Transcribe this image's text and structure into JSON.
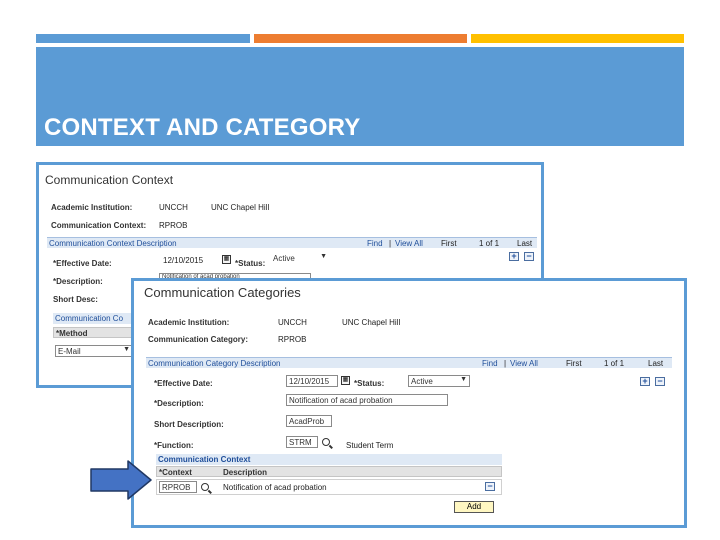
{
  "colors": {
    "accent_blue": "#5b9bd5",
    "accent_orange": "#ed7d31",
    "accent_gold": "#ffc000",
    "arrow_fill": "#4472c4",
    "arrow_border": "#203864"
  },
  "slide": {
    "title": "CONTEXT AND CATEGORY"
  },
  "context_page": {
    "title": "Communication Context",
    "academic_institution_label": "Academic Institution:",
    "academic_institution_code": "UNCCH",
    "academic_institution_name": "UNC Chapel Hill",
    "communication_context_label": "Communication Context:",
    "communication_context_value": "RPROB",
    "section_title": "Communication Context Description",
    "nav": {
      "find": "Find",
      "sep": "|",
      "view_all": "View All",
      "first": "First",
      "page_info": "1 of 1",
      "last": "Last"
    },
    "effective_date_label": "*Effective Date:",
    "effective_date_value": "12/10/2015",
    "status_label": "*Status:",
    "status_value": "Active",
    "description_label": "*Description:",
    "description_value": "Notification of acad probation",
    "short_desc_label": "Short Desc:",
    "grid_title": "Communication Co",
    "method_header": "*Method",
    "method_value": "E-Mail"
  },
  "category_page": {
    "title": "Communication Categories",
    "academic_institution_label": "Academic Institution:",
    "academic_institution_code": "UNCCH",
    "academic_institution_name": "UNC Chapel Hill",
    "communication_category_label": "Communication Category:",
    "communication_category_value": "RPROB",
    "section_title": "Communication Category Description",
    "nav": {
      "find": "Find",
      "sep": "|",
      "view_all": "View All",
      "first": "First",
      "page_info": "1 of 1",
      "last": "Last"
    },
    "effective_date_label": "*Effective Date:",
    "effective_date_value": "12/10/2015",
    "status_label": "*Status:",
    "status_value": "Active",
    "description_label": "*Description:",
    "description_value": "Notification of acad probation",
    "short_description_label": "Short Description:",
    "short_description_value": "AcadProb",
    "function_label": "*Function:",
    "function_value": "STRM",
    "function_desc": "Student Term",
    "grid_title": "Communication Context",
    "col_context": "*Context",
    "col_description": "Description",
    "row": {
      "context": "RPROB",
      "description": "Notification of acad probation"
    },
    "add_button": "Add"
  }
}
